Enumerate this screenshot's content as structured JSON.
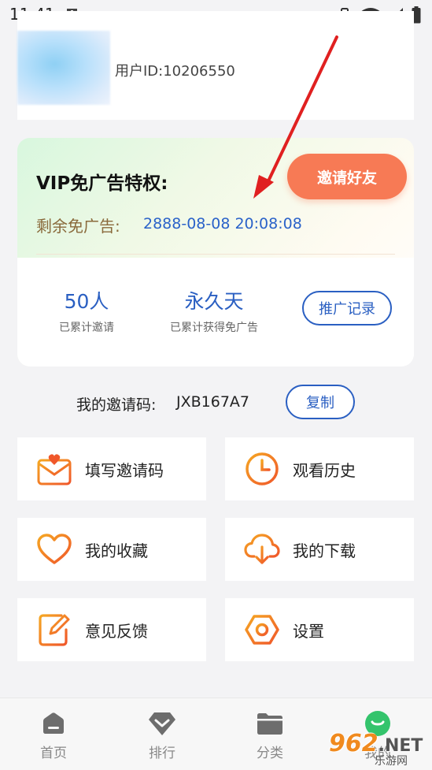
{
  "status_bar": {
    "time": "11:41"
  },
  "profile": {
    "user_id_text": "用户ID:10206550"
  },
  "vip": {
    "title": "VIP免广告特权:",
    "invite_button": "邀请好友",
    "remaining_label": "剩余免广告:",
    "remaining_value": "2888-08-08 20:08:08",
    "stats": [
      {
        "value": "50人",
        "label": "已累计邀请"
      },
      {
        "value": "永久天",
        "label": "已累计获得免广告"
      }
    ],
    "record_button": "推广记录"
  },
  "invite_code": {
    "label": "我的邀请码:",
    "value": "JXB167A7",
    "copy_button": "复制"
  },
  "menu": [
    {
      "label": "填写邀请码",
      "icon": "envelope-heart-icon"
    },
    {
      "label": "观看历史",
      "icon": "clock-icon"
    },
    {
      "label": "我的收藏",
      "icon": "heart-icon"
    },
    {
      "label": "我的下载",
      "icon": "cloud-download-icon"
    },
    {
      "label": "意见反馈",
      "icon": "edit-icon"
    },
    {
      "label": "设置",
      "icon": "hexagon-settings-icon"
    }
  ],
  "bottom_nav": [
    {
      "label": "首页",
      "icon": "home-icon"
    },
    {
      "label": "排行",
      "icon": "diamond-icon"
    },
    {
      "label": "分类",
      "icon": "folder-icon"
    },
    {
      "label": "我的",
      "icon": "profile-icon"
    }
  ],
  "watermark": {
    "brand": "962",
    "net": ".NET",
    "sub": "乐游网"
  },
  "colors": {
    "accent_orange": "#f77a55",
    "accent_blue": "#2a5fc2",
    "icon_gradient_start": "#f5a623",
    "icon_gradient_end": "#f0572a",
    "arrow_red": "#e02020"
  }
}
